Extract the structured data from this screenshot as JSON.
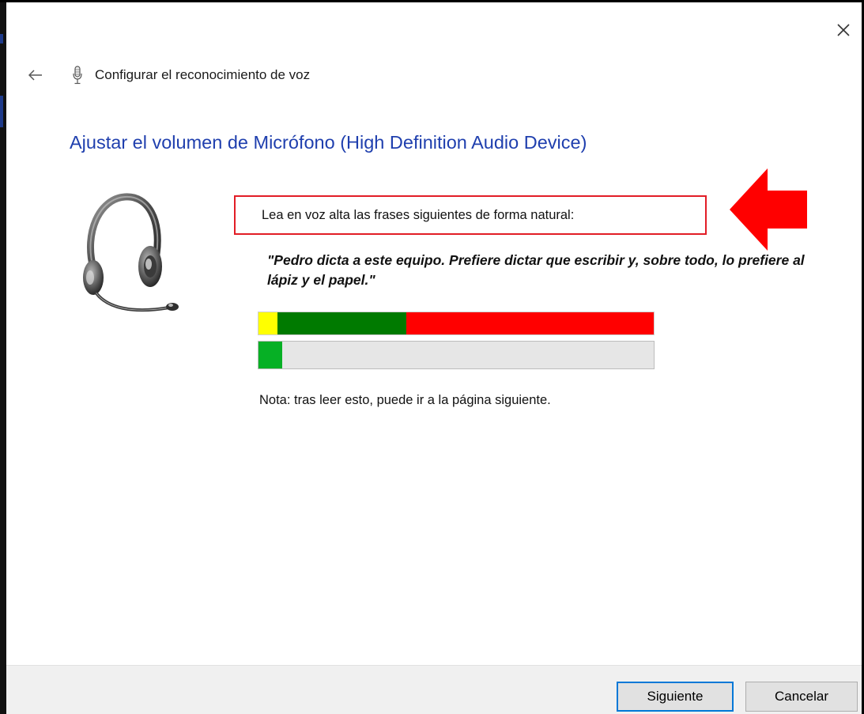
{
  "window": {
    "title": "Configurar el reconocimiento de voz",
    "back_icon": "back-arrow-icon",
    "mic_icon": "microphone-icon",
    "close_icon": "close-icon"
  },
  "page": {
    "heading": "Ajustar el volumen de Micrófono (High Definition Audio Device)",
    "instruction": "Lea en voz alta las frases siguientes de forma natural:",
    "quote": "\"Pedro dicta a este equipo. Prefiere dictar que escribir y, sobre todo, lo prefiere al lápiz y el papel.\"",
    "note": "Nota: tras leer esto, puede ir a la página siguiente.",
    "volume_level_percent": 6
  },
  "buttons": {
    "next": "Siguiente",
    "cancel": "Cancelar"
  },
  "colors": {
    "heading": "#1f3fae",
    "highlight_box": "#e21d26",
    "arrow": "#ff0000",
    "level_low": "#ffff00",
    "level_good": "#007a00",
    "level_high": "#ff0000",
    "volume_fill": "#06b025"
  }
}
